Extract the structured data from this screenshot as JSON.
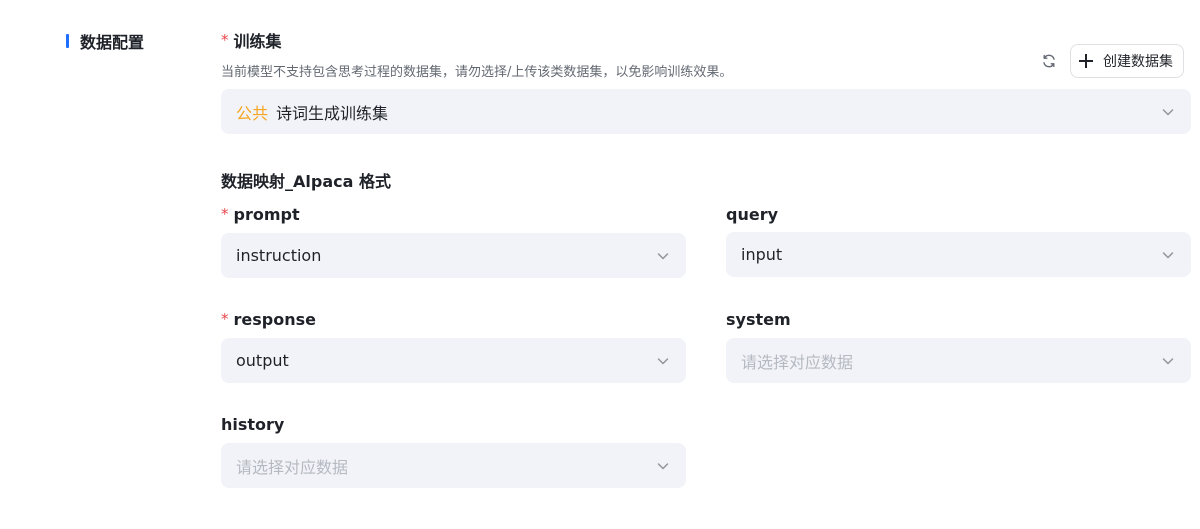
{
  "section": {
    "title": "数据配置"
  },
  "training_set": {
    "label": "训练集",
    "required_mark": "*",
    "hint": "当前模型不支持包含思考过程的数据集，请勿选择/上传该类数据集，以免影响训练效果。",
    "tag": "公共",
    "value": "诗词生成训练集",
    "create_button": "创建数据集"
  },
  "mapping": {
    "heading": "数据映射_Alpaca 格式",
    "fields": {
      "prompt": {
        "label": "prompt",
        "required_mark": "*",
        "value": "instruction"
      },
      "query": {
        "label": "query",
        "value": "input"
      },
      "response": {
        "label": "response",
        "required_mark": "*",
        "value": "output"
      },
      "system": {
        "label": "system",
        "placeholder": "请选择对应数据"
      },
      "history": {
        "label": "history",
        "placeholder": "请选择对应数据"
      }
    }
  },
  "colors": {
    "accent": "#1e6fff",
    "required": "#e5484d",
    "tag": "#f5a623",
    "field_bg": "#f2f3f8"
  },
  "icons": {
    "refresh": "refresh-icon",
    "plus": "plus-icon",
    "chevron": "chevron-down-icon"
  }
}
